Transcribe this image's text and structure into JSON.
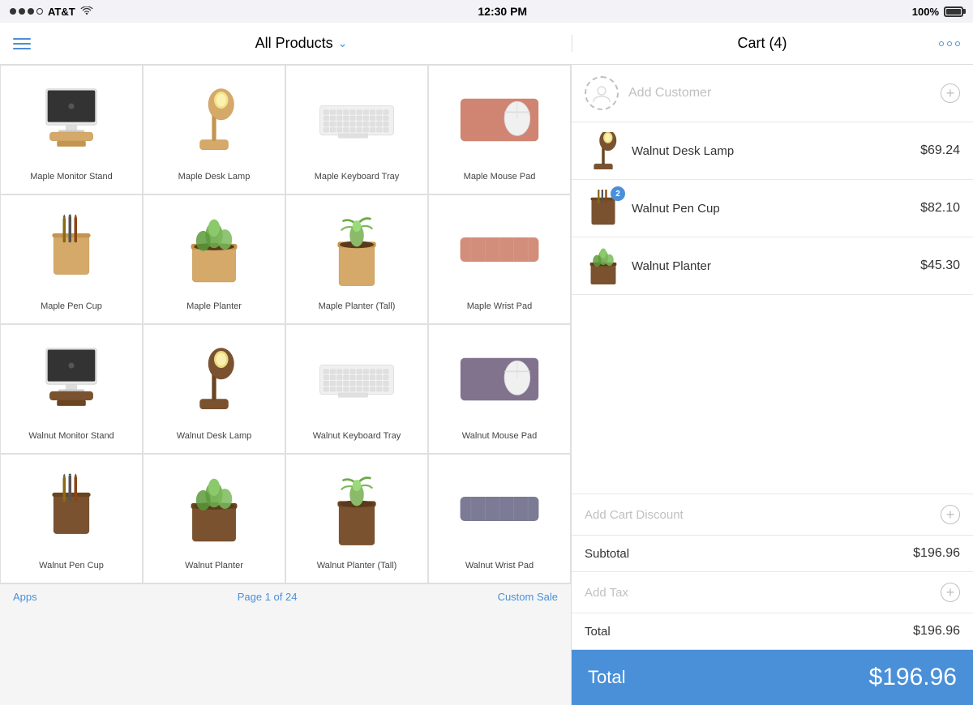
{
  "status_bar": {
    "carrier": "AT&T",
    "time": "12:30 PM",
    "battery": "100%"
  },
  "header": {
    "menu_label": "Menu",
    "title": "All Products",
    "chevron": "∨",
    "cart_title": "Cart (4)",
    "more_label": "More options"
  },
  "products": [
    {
      "id": 1,
      "name": "Maple Monitor Stand",
      "type": "monitor-stand",
      "variant": "maple"
    },
    {
      "id": 2,
      "name": "Maple Desk Lamp",
      "type": "desk-lamp",
      "variant": "maple"
    },
    {
      "id": 3,
      "name": "Maple Keyboard Tray",
      "type": "keyboard-tray",
      "variant": "maple"
    },
    {
      "id": 4,
      "name": "Maple Mouse Pad",
      "type": "mouse-pad",
      "variant": "maple"
    },
    {
      "id": 5,
      "name": "Maple Pen Cup",
      "type": "pen-cup",
      "variant": "maple"
    },
    {
      "id": 6,
      "name": "Maple Planter",
      "type": "planter",
      "variant": "maple"
    },
    {
      "id": 7,
      "name": "Maple Planter (Tall)",
      "type": "planter-tall",
      "variant": "maple"
    },
    {
      "id": 8,
      "name": "Maple Wrist Pad",
      "type": "wrist-pad",
      "variant": "maple"
    },
    {
      "id": 9,
      "name": "Walnut Monitor Stand",
      "type": "monitor-stand",
      "variant": "walnut"
    },
    {
      "id": 10,
      "name": "Walnut Desk Lamp",
      "type": "desk-lamp",
      "variant": "walnut"
    },
    {
      "id": 11,
      "name": "Walnut Keyboard Tray",
      "type": "keyboard-tray",
      "variant": "walnut"
    },
    {
      "id": 12,
      "name": "Walnut Mouse Pad",
      "type": "mouse-pad",
      "variant": "walnut"
    },
    {
      "id": 13,
      "name": "Walnut Pen Cup",
      "type": "pen-cup",
      "variant": "walnut"
    },
    {
      "id": 14,
      "name": "Walnut Planter",
      "type": "planter",
      "variant": "walnut"
    },
    {
      "id": 15,
      "name": "Walnut Planter (Tall)",
      "type": "planter-tall",
      "variant": "walnut"
    },
    {
      "id": 16,
      "name": "Walnut Wrist Pad",
      "type": "wrist-pad",
      "variant": "walnut"
    }
  ],
  "cart": {
    "add_customer_label": "Add Customer",
    "items": [
      {
        "name": "Walnut Desk Lamp",
        "price": "$69.24",
        "qty": 1,
        "type": "desk-lamp",
        "variant": "walnut"
      },
      {
        "name": "Walnut Pen Cup",
        "price": "$82.10",
        "qty": 2,
        "type": "pen-cup",
        "variant": "walnut"
      },
      {
        "name": "Walnut Planter",
        "price": "$45.30",
        "qty": 1,
        "type": "planter",
        "variant": "walnut"
      }
    ],
    "add_discount_label": "Add Cart Discount",
    "subtotal_label": "Subtotal",
    "subtotal_value": "$196.96",
    "add_tax_label": "Add Tax",
    "total_label": "Total",
    "total_value": "$196.96",
    "total_bar_label": "Total",
    "total_bar_value": "$196.96"
  },
  "bottom_bar": {
    "apps_label": "Apps",
    "page_label": "Page 1 of 24",
    "custom_sale_label": "Custom Sale"
  }
}
